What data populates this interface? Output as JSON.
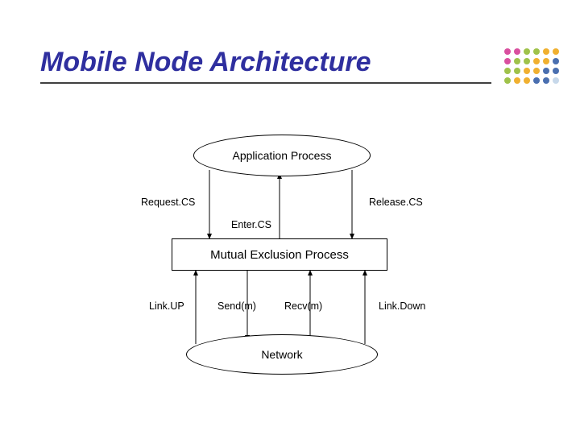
{
  "title": "Mobile Node Architecture",
  "nodes": {
    "application_process": "Application Process",
    "mutual_exclusion_process": "Mutual Exclusion Process",
    "network": "Network"
  },
  "labels": {
    "request_cs": "Request.CS",
    "release_cs": "Release.CS",
    "enter_cs": "Enter.CS",
    "link_up": "Link.UP",
    "link_down": "Link.Down",
    "send_m": "Send(m)",
    "recv_m": "Recv(m)"
  },
  "decoration": {
    "dot_colors": [
      "#d94f9f",
      "#9fc24a",
      "#f0b030",
      "#4a6fb0"
    ]
  }
}
